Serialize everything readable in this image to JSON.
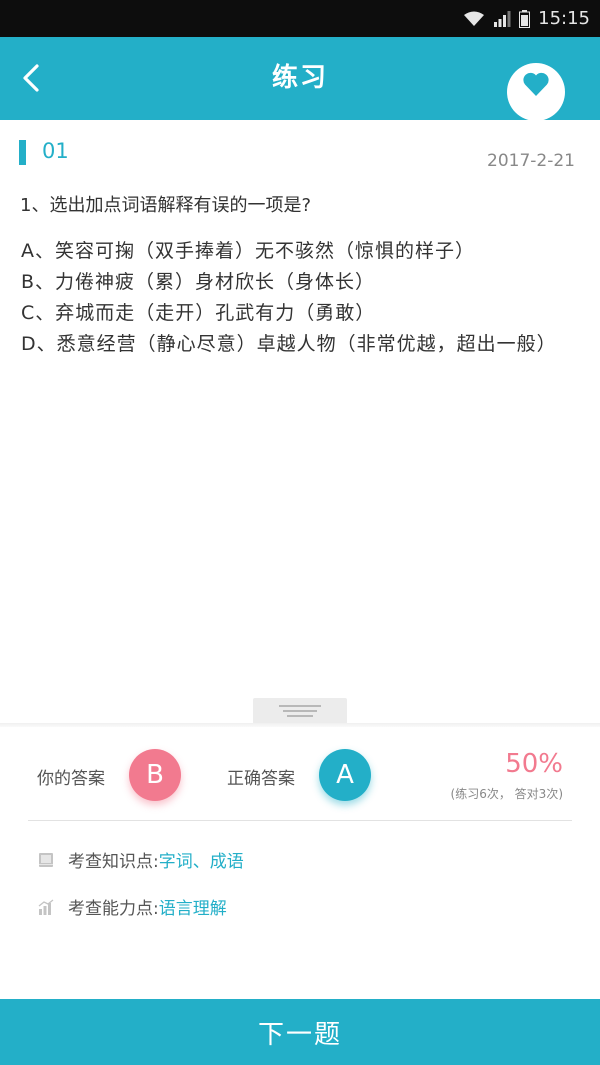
{
  "status_bar": {
    "time": "15:15"
  },
  "header": {
    "title": "练习"
  },
  "question": {
    "number": "01",
    "date": "2017-2-21",
    "stem": "1、选出加点词语解释有误的一项是?",
    "options": [
      "A、笑容可掬（双手捧着）无不骇然（惊惧的样子）",
      "B、力倦神疲（累）身材欣长（身体长）",
      "C、弃城而走（走开）孔武有力（勇敢）",
      "D、悉意经营（静心尽意）卓越人物（非常优越，超出一般）"
    ]
  },
  "answer_panel": {
    "your_answer_label": "你的答案",
    "your_answer": "B",
    "correct_answer_label": "正确答案",
    "correct_answer": "A",
    "accuracy": "50%",
    "accuracy_detail": "(练习6次， 答对3次)",
    "knowledge_point_label": "考查知识点:",
    "knowledge_point_value": "字词、成语",
    "ability_point_label": "考查能力点:",
    "ability_point_value": "语言理解"
  },
  "footer": {
    "next_label": "下一题"
  },
  "colors": {
    "primary": "#23afc8",
    "wrong": "#f27a8f",
    "status_bar": "#0d0d0d"
  }
}
